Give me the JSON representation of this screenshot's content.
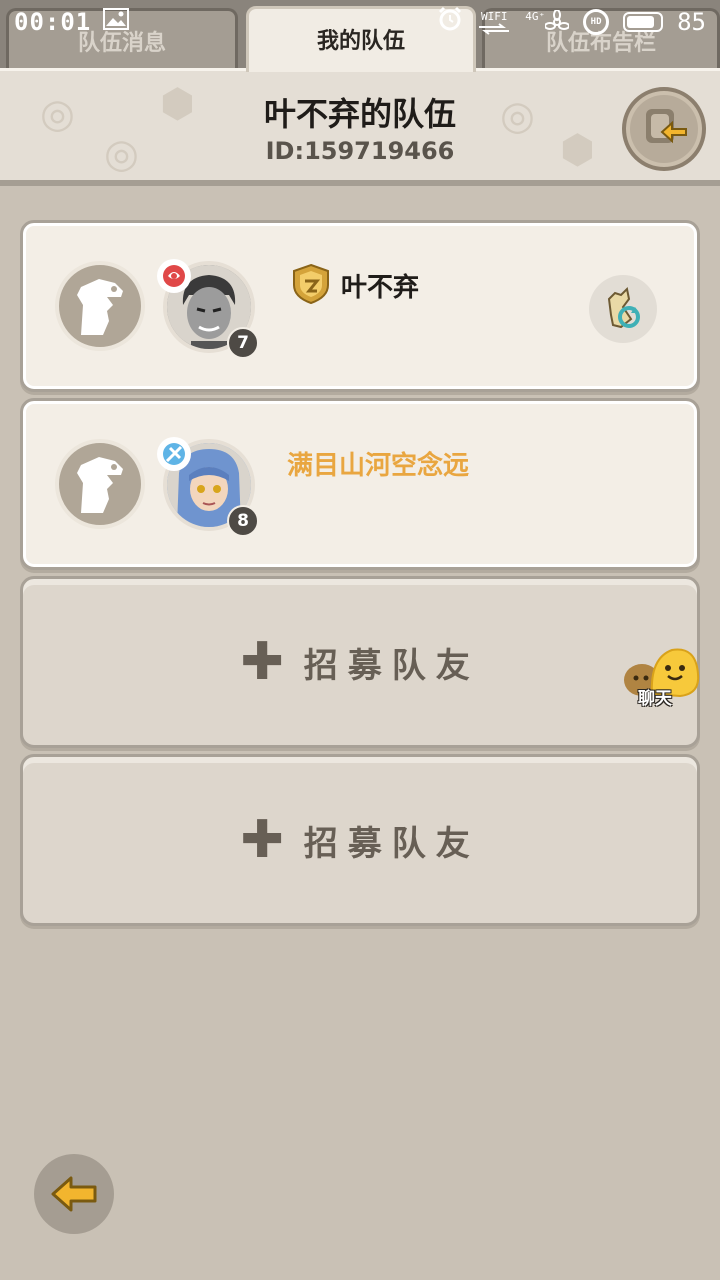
{
  "status_bar": {
    "time": "00:01",
    "network": "4G⁺",
    "wifi_label": "WIFI",
    "hd_label": "HD",
    "battery": "85",
    "battery_level": 0.85
  },
  "tabs": [
    {
      "label": "队伍消息",
      "active": false
    },
    {
      "label": "我的队伍",
      "active": true
    },
    {
      "label": "队伍布告栏",
      "active": false
    }
  ],
  "header": {
    "title": "叶不弃的队伍",
    "team_id": "ID:159719466"
  },
  "members": [
    {
      "name": "叶不弃",
      "level": "7",
      "is_leader": true,
      "name_color": "#1f1c19"
    },
    {
      "name": "满目山河空念远",
      "level": "8",
      "is_leader": false,
      "name_color": "#e9a640"
    }
  ],
  "recruit_slots": [
    {
      "label": "招募队友"
    },
    {
      "label": "招募队友"
    }
  ],
  "chat": {
    "label": "聊天"
  },
  "colors": {
    "background": "#c9c1b5",
    "card": "#f3eee6",
    "accent_orange": "#e9a640",
    "gold": "#d4a33a"
  },
  "icons": [
    "exit-team-icon",
    "leader-shield-icon",
    "swap-position-icon",
    "back-arrow-icon",
    "chat-bubble-icon",
    "dinosaur-placeholder-icon"
  ]
}
